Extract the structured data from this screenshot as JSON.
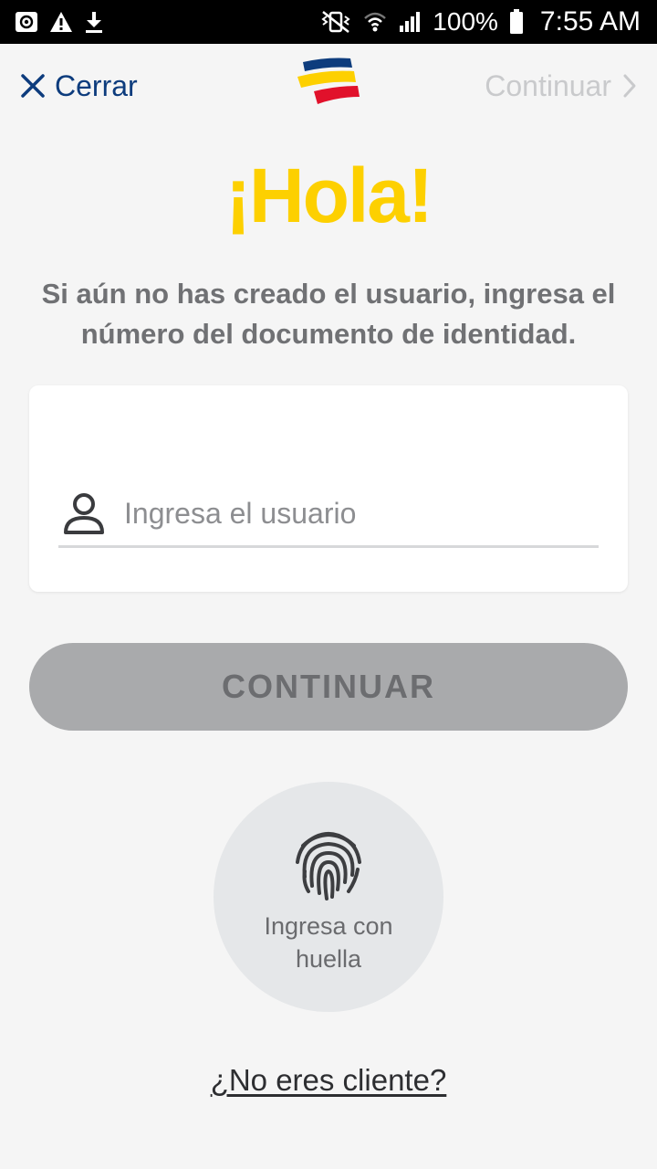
{
  "status_bar": {
    "left_icons": [
      "at-icon",
      "warning-icon",
      "download-icon"
    ],
    "battery_text": "100%",
    "time": "7:55 AM"
  },
  "header": {
    "close_label": "Cerrar",
    "continue_label": "Continuar"
  },
  "main": {
    "title": "¡Hola!",
    "subtitle": "Si aún no has creado el usuario, ingresa el número del documento de identidad.",
    "username_placeholder": "Ingresa el usuario",
    "username_value": "",
    "continue_button": "CONTINUAR",
    "fingerprint_label": "Ingresa con huella",
    "not_client_link": "¿No eres cliente?"
  },
  "colors": {
    "accent_yellow": "#fdd000",
    "brand_blue": "#0d3c7d",
    "brand_red": "#e1112b",
    "disabled_button": "#a9aaac"
  }
}
